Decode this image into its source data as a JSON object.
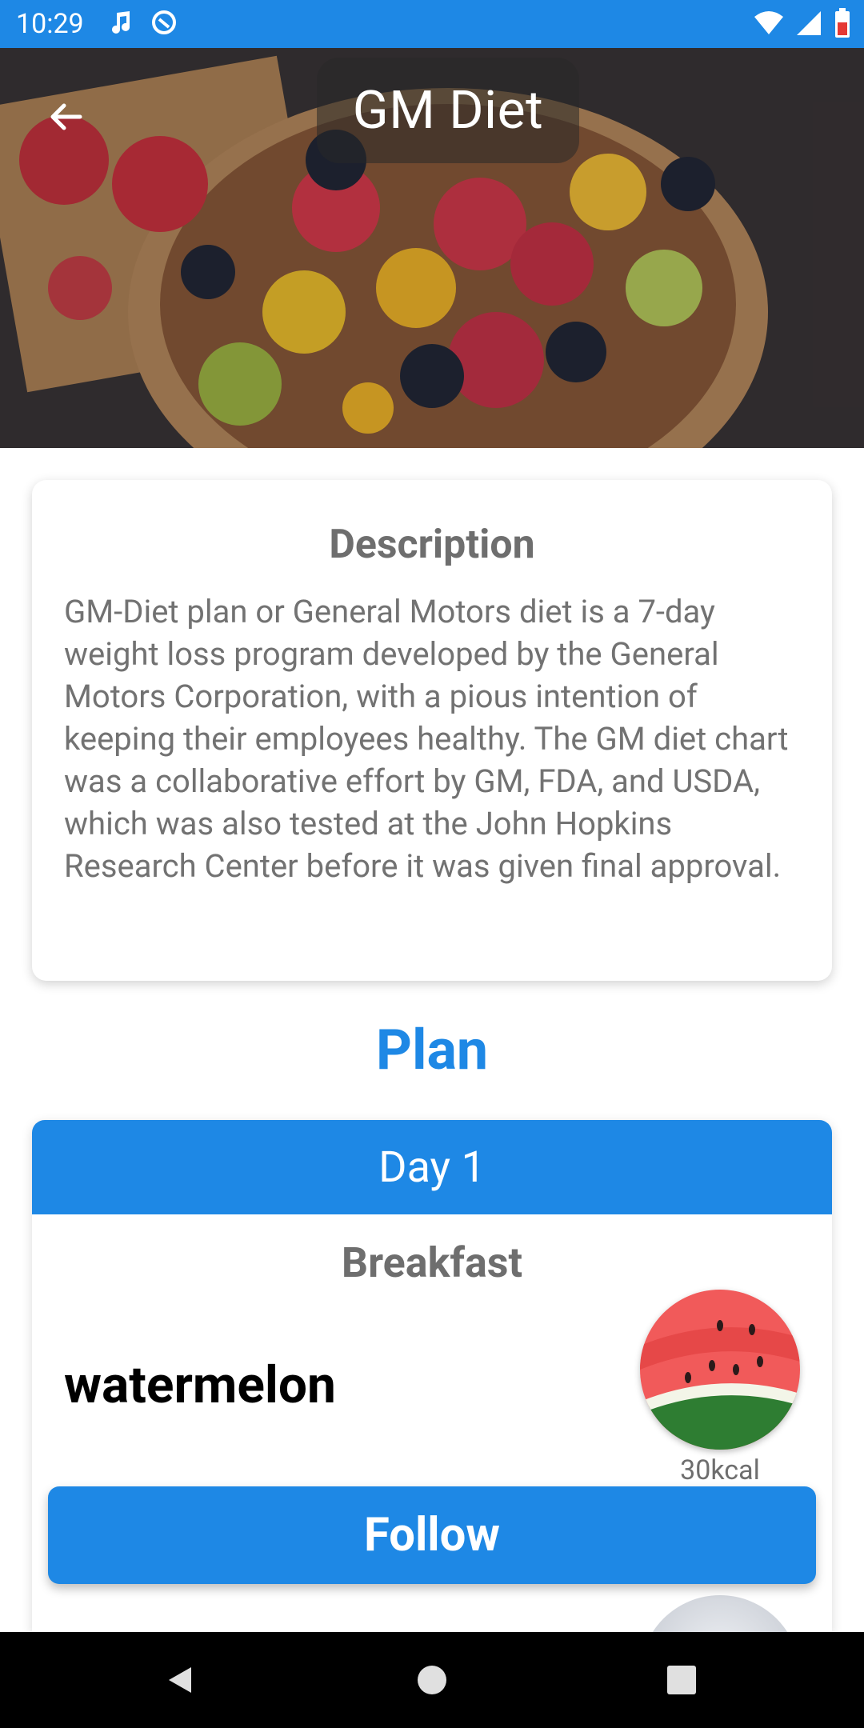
{
  "status_bar": {
    "time": "10:29",
    "icons": [
      "music-note-icon",
      "sync-icon",
      "wifi-icon",
      "signal-icon",
      "battery-icon"
    ]
  },
  "header": {
    "title": "GM Diet",
    "back_icon": "arrow-back-icon"
  },
  "description": {
    "title": "Description",
    "body": "GM-Diet plan or General Motors diet is a 7-day weight loss program developed by the General Motors Corporation, with a pious intention of keeping their employees healthy. The GM diet chart was a collaborative effort by GM, FDA, and USDA, which was also tested at the John Hopkins Research Center before it was given final approval."
  },
  "plan": {
    "heading": "Plan",
    "day": {
      "label": "Day 1",
      "meal": "Breakfast",
      "items": [
        {
          "name": "watermelon",
          "kcal": "30kcal",
          "image": "watermelon-image"
        }
      ]
    }
  },
  "actions": {
    "follow_label": "Follow"
  },
  "nav": {
    "back": "nav-back-icon",
    "home": "nav-home-icon",
    "recents": "nav-recents-icon"
  },
  "colors": {
    "primary": "#1E88E5",
    "text_gray": "#6e6e6e"
  }
}
